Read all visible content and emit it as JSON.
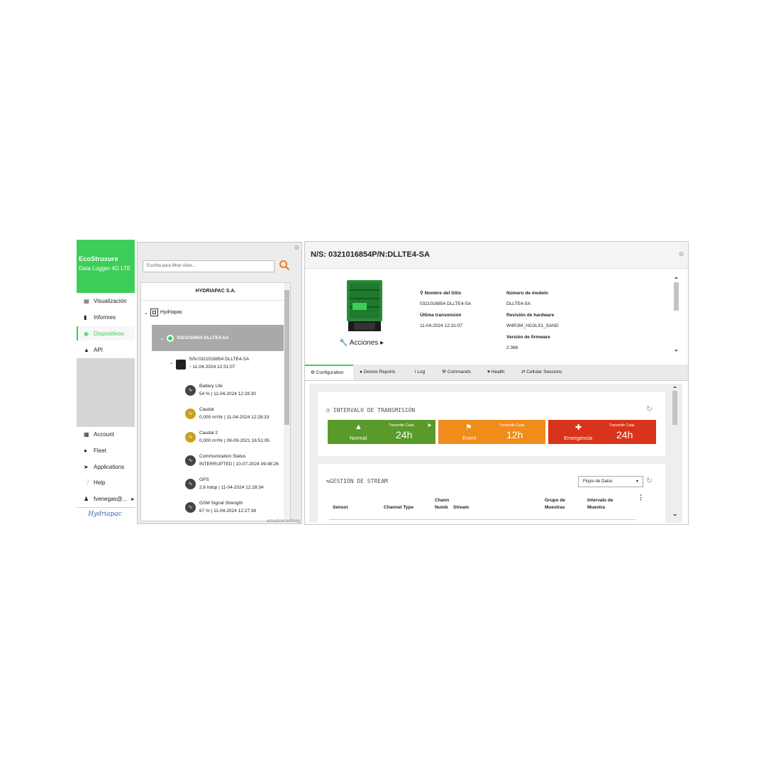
{
  "brand": {
    "name": "EcoStruxure",
    "product": "Data Logger 4G LTE",
    "color": "#3dcd58"
  },
  "nav": {
    "top_items": [
      {
        "label": "Visualización",
        "icon": "chart-icon"
      },
      {
        "label": "Informes",
        "icon": "document-icon"
      },
      {
        "label": "Dispositivos",
        "icon": "devices-icon",
        "active": true
      },
      {
        "label": "API",
        "icon": "api-icon"
      }
    ],
    "bottom_items": [
      {
        "label": "Account",
        "icon": "account-icon"
      },
      {
        "label": "Fleet",
        "icon": "fleet-icon"
      },
      {
        "label": "Applications",
        "icon": "rocket-icon"
      },
      {
        "label": "Help",
        "icon": "help-icon"
      },
      {
        "label": "fvenegas@...",
        "icon": "user-icon"
      }
    ],
    "logo_text": "Hydriapac"
  },
  "tree": {
    "search_placeholder": "Escriba para filtrar sitios...",
    "org": "HYDRIAPAC S.A.",
    "group": "Hydriapac",
    "site": "0321016854 DLLTE4-SA",
    "device": {
      "sn": "S/N:0321016854 DLLTE4-SA",
      "date": "11-04-2024 12:31:07"
    },
    "sensors": [
      {
        "name": "Battery Life",
        "value": "54 % | 11-04-2024 12:28:30",
        "kind": "dark"
      },
      {
        "name": "Caudal",
        "value": "0,000 m³/hr | 11-04-2024 12:28:33",
        "kind": "gold"
      },
      {
        "name": "Caudal 2",
        "value": "0,000 m³/hr | 09-09-2021 16:51:05",
        "kind": "gold"
      },
      {
        "name": "Communication Status",
        "value": "INTERRUPTED | 10-07-2024 09:48:26",
        "kind": "dark"
      },
      {
        "name": "GPS",
        "value": "2,6 hdop | 11-04-2024 12:28:34",
        "kind": "dark"
      },
      {
        "name": "GSM Signal Strength",
        "value": "67 % | 11-04-2024 12:27:38",
        "kind": "dark"
      }
    ],
    "update_text": "actualizar en6seg"
  },
  "detail": {
    "title": "N/S: 0321016854P/N:DLLTE4-SA",
    "acciones": "Acciones",
    "info_left": [
      {
        "label": "Nombre del Sitio",
        "value": "0321016854 DLLTE4-SA"
      },
      {
        "label": "Última transmisión",
        "value": "11-04-2024 12:31:07"
      }
    ],
    "info_right": [
      {
        "label": "Número de modelo",
        "value": "DLLTE4-SA"
      },
      {
        "label": "Revisión de hardware",
        "value": "W4R2M_HG3LS1_SAND"
      },
      {
        "label": "Versión de firmware",
        "value": "2.366"
      }
    ],
    "tabs": [
      "Configuration",
      "Device Reports",
      "Log",
      "Commands",
      "Health",
      "Cellular Sessions"
    ]
  },
  "transmission": {
    "title": "INTERVALO DE TRANSMISIÓN",
    "tiles": [
      {
        "name": "Normal",
        "caption": "Transmitir Cada",
        "value": "24h",
        "color": "#5a9a2a"
      },
      {
        "name": "Event",
        "caption": "Transmitir Cada",
        "value": "12h",
        "color": "#ef8c1a"
      },
      {
        "name": "Emergencia",
        "caption": "Transmitir Cada",
        "value": "24h",
        "color": "#d9341b"
      }
    ]
  },
  "stream": {
    "title": "GESTIÓN DE STREAM",
    "select_value": "Flujos de Datos",
    "columns": [
      "Sensor",
      "Channel Type",
      "Chann Numb",
      "Stream",
      "Grupo de Muestras",
      "Intervalo de Muestra"
    ]
  }
}
